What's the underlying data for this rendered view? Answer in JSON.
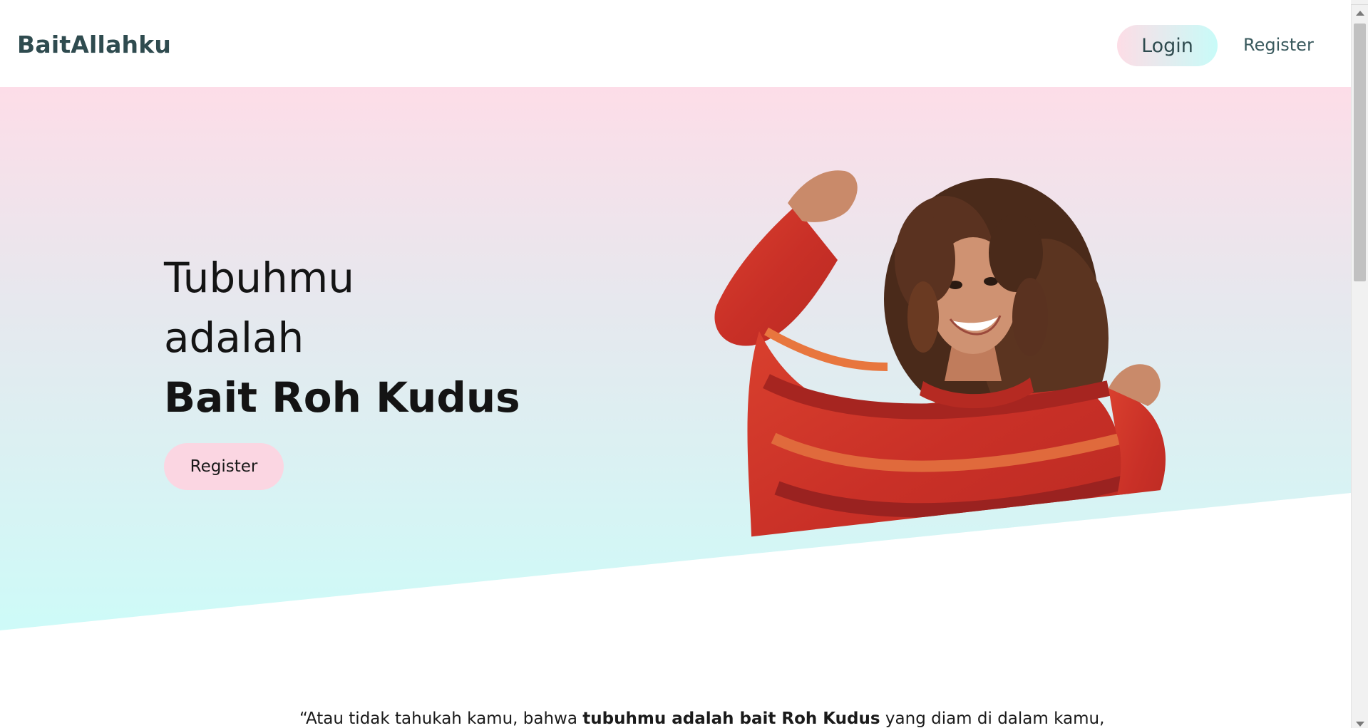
{
  "header": {
    "brand": "BaitAllahku",
    "login_label": "Login",
    "register_label": "Register"
  },
  "hero": {
    "line1": "Tubuhmu",
    "line2": "adalah",
    "line3": "Bait Roh Kudus",
    "register_label": "Register"
  },
  "quote": {
    "part1": "“Atau tidak tahukah kamu, bahwa ",
    "bold": "tubuhmu adalah bait Roh Kudus",
    "part2": " yang diam di dalam kamu,"
  },
  "colors": {
    "brand_text": "#2f4b4f",
    "gradient_top": "#fddde8",
    "gradient_bottom": "#cdfbf8",
    "button_pink": "#fbd6e2"
  }
}
